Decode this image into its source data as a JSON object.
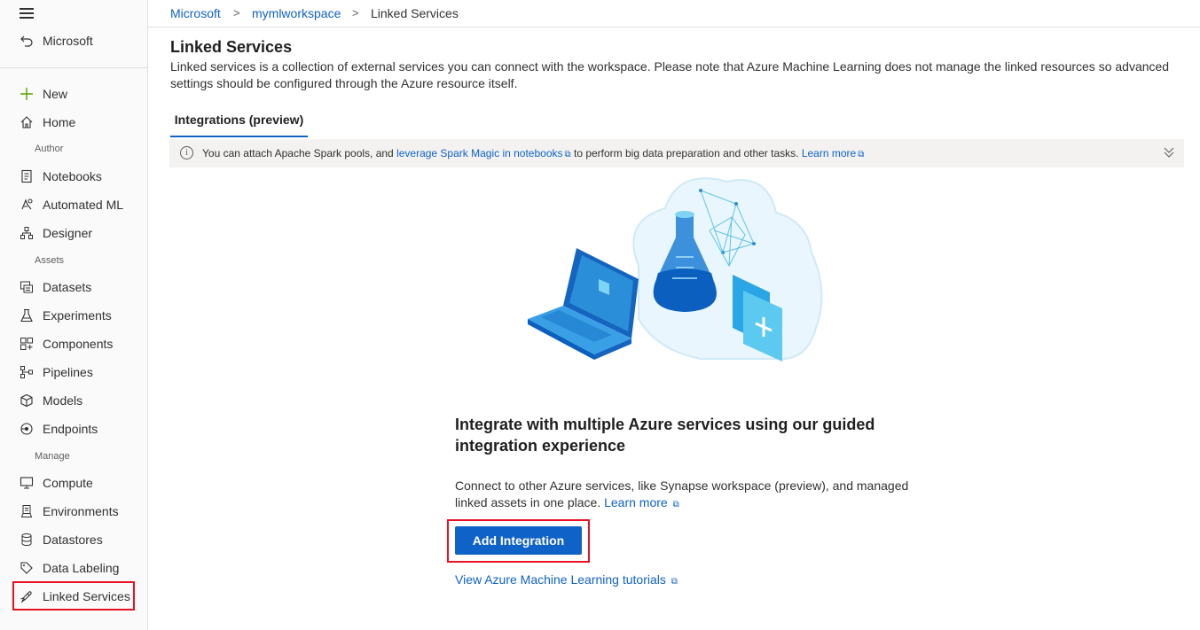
{
  "sidebar": {
    "back_label": "Microsoft",
    "new_label": "New",
    "home_label": "Home",
    "sections": {
      "author": "Author",
      "assets": "Assets",
      "manage": "Manage"
    },
    "author_items": [
      {
        "label": "Notebooks",
        "icon": "notebook-icon"
      },
      {
        "label": "Automated ML",
        "icon": "automated-ml-icon"
      },
      {
        "label": "Designer",
        "icon": "designer-icon"
      }
    ],
    "assets_items": [
      {
        "label": "Datasets",
        "icon": "datasets-icon"
      },
      {
        "label": "Experiments",
        "icon": "flask-icon"
      },
      {
        "label": "Components",
        "icon": "components-icon"
      },
      {
        "label": "Pipelines",
        "icon": "pipelines-icon"
      },
      {
        "label": "Models",
        "icon": "cube-icon"
      },
      {
        "label": "Endpoints",
        "icon": "endpoints-icon"
      }
    ],
    "manage_items": [
      {
        "label": "Compute",
        "icon": "monitor-icon"
      },
      {
        "label": "Environments",
        "icon": "environment-icon"
      },
      {
        "label": "Datastores",
        "icon": "database-icon"
      },
      {
        "label": "Data Labeling",
        "icon": "tag-icon"
      },
      {
        "label": "Linked Services",
        "icon": "link-icon"
      }
    ],
    "active_item": "Linked Services"
  },
  "breadcrumb": {
    "items": [
      "Microsoft",
      "mymlworkspace",
      "Linked Services"
    ],
    "separator": ">"
  },
  "page": {
    "title": "Linked Services",
    "description": "Linked services is a collection of external services you can connect with the workspace. Please note that Azure Machine Learning does not manage the linked resources so advanced settings should be configured through the Azure resource itself.",
    "tab": "Integrations (preview)"
  },
  "info_bar": {
    "text_before": "You can attach Apache Spark pools, and ",
    "link1": "leverage Spark Magic in notebooks",
    "text_after": " to perform big data preparation and other tasks. ",
    "link2": "Learn more"
  },
  "empty_state": {
    "heading": "Integrate with multiple Azure services using our guided integration experience",
    "body": "Connect to other Azure services, like Synapse workspace (preview), and managed linked assets in one place. ",
    "learn_more": "Learn more",
    "button_label": "Add Integration",
    "tutorials_link": "View Azure Machine Learning tutorials"
  },
  "colors": {
    "accent": "#0f62c7",
    "highlight_border": "#e81123",
    "new_plus": "#57a300"
  }
}
